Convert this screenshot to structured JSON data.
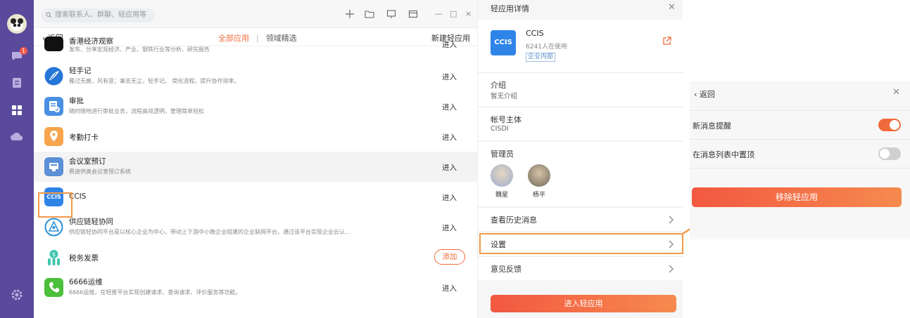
{
  "colors": {
    "rail": "#5a4a9c",
    "accent": "#f06b3c",
    "annotation": "#f2994a",
    "ccis": "#2f84e8"
  },
  "rail": {
    "badge": "1",
    "icons": [
      "chat-icon",
      "document-icon",
      "apps-icon",
      "cloud-icon",
      "settings-icon"
    ]
  },
  "search": {
    "placeholder": "搜索联系人、群聊、轻应用等"
  },
  "subbar": {
    "back": "返回",
    "tab_all": "全部应用",
    "separator": "|",
    "tab_domain": "领域精选",
    "create": "新建轻应用"
  },
  "apps": [
    {
      "name": "香港经济观察",
      "desc": "发布、分享宏观经济、产业、钢铁行业等分析、研究报告",
      "action": "进入",
      "icon": "chart-app-icon"
    },
    {
      "name": "轻手记",
      "desc": "雁过无痕，风有意；事去无尘，轻手记。 简化流程，提升协作效率。",
      "action": "进入",
      "icon": "feather-app-icon"
    },
    {
      "name": "审批",
      "desc": "随时随地进行审批业务，流程高效透明，管理简单轻松",
      "action": "进入",
      "icon": "approval-app-icon"
    },
    {
      "name": "考勤打卡",
      "desc": "",
      "action": "进入",
      "icon": "location-app-icon"
    },
    {
      "name": "会议室预订",
      "desc": "费迪供奥会议室预订系统",
      "action": "进入",
      "icon": "meeting-app-icon"
    },
    {
      "name": "CCIS",
      "desc": "",
      "action": "进入",
      "icon": "ccis-app-icon"
    },
    {
      "name": "供应链轻协同",
      "desc": "供应链轻协同平台是以核心企业为中心，带动上下游中小微企业组建的企业联网平台，通过该平台实现企业云认...",
      "action": "进入",
      "icon": "supply-chain-app-icon"
    },
    {
      "name": "税务发票",
      "desc": "",
      "action": "添加",
      "icon": "tax-app-icon"
    },
    {
      "name": "6666运维",
      "desc": "6666运维，在轻推平台实现创建请求、查询请求、评价服务等功能。",
      "action": "进入",
      "icon": "phone-app-icon"
    }
  ],
  "detail": {
    "title": "轻应用详情",
    "app_name": "CCIS",
    "logo_text": "CCIS",
    "users": "6241人在使用",
    "tag": "企业内部",
    "intro_label": "介绍",
    "intro_value": "暂无介绍",
    "account_label": "帐号主体",
    "account_value": "CISDI",
    "admin_label": "管理员",
    "admins": [
      "魏星",
      "杨平"
    ],
    "history": "查看历史消息",
    "settings": "设置",
    "feedback": "意见反馈",
    "enter_button": "进入轻应用"
  },
  "popup": {
    "back": "返回",
    "new_message_alert": "新消息提醒",
    "new_message_alert_on": true,
    "pin_to_top": "在消息列表中置顶",
    "pin_to_top_on": false,
    "remove_button": "移除轻应用"
  }
}
